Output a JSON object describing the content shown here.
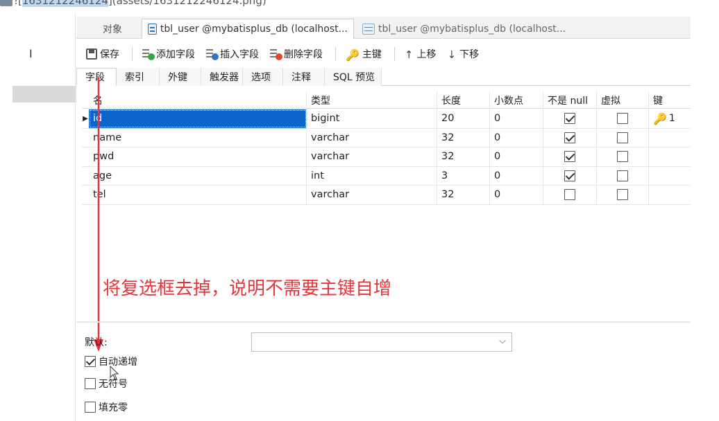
{
  "md_link": {
    "prefix": "![",
    "selected": "1631212246124",
    "suffix": "](assets/1631212246124.png)"
  },
  "tabs": {
    "objects": "对象",
    "active": "tbl_user @mybatisplus_db (localhost...",
    "inactive": "tbl_user @mybatisplus_db (localhost..."
  },
  "toolbar": {
    "save": "保存",
    "add_field": "添加字段",
    "insert_field": "插入字段",
    "delete_field": "删除字段",
    "primary_key": "主键",
    "move_up": "上移",
    "move_down": "下移"
  },
  "subtabs": [
    "字段",
    "索引",
    "外键",
    "触发器",
    "选项",
    "注释",
    "SQL 预览"
  ],
  "grid": {
    "headers": [
      "名",
      "类型",
      "长度",
      "小数点",
      "不是 null",
      "虚拟",
      "键"
    ],
    "rows": [
      {
        "name": "id",
        "type": "bigint",
        "length": "20",
        "decimals": "0",
        "not_null": true,
        "virtual": false,
        "key": "1",
        "selected": true
      },
      {
        "name": "name",
        "type": "varchar",
        "length": "32",
        "decimals": "0",
        "not_null": true,
        "virtual": false,
        "key": "",
        "selected": false
      },
      {
        "name": "pwd",
        "type": "varchar",
        "length": "32",
        "decimals": "0",
        "not_null": true,
        "virtual": false,
        "key": "",
        "selected": false
      },
      {
        "name": "age",
        "type": "int",
        "length": "3",
        "decimals": "0",
        "not_null": true,
        "virtual": false,
        "key": "",
        "selected": false
      },
      {
        "name": "tel",
        "type": "varchar",
        "length": "32",
        "decimals": "0",
        "not_null": false,
        "virtual": false,
        "key": "",
        "selected": false
      }
    ]
  },
  "annotation": "将复选框去掉，说明不需要主键自增",
  "field_props": {
    "default_label": "默认:",
    "default_value": "",
    "auto_increment": {
      "label": "自动递增",
      "checked": true
    },
    "unsigned": {
      "label": "无符号",
      "checked": false
    },
    "zerofill": {
      "label": "填充零",
      "checked": false
    }
  },
  "colors": {
    "selection": "#0a64c9",
    "annotation": "#e8343b",
    "key": "#e0a21c"
  }
}
